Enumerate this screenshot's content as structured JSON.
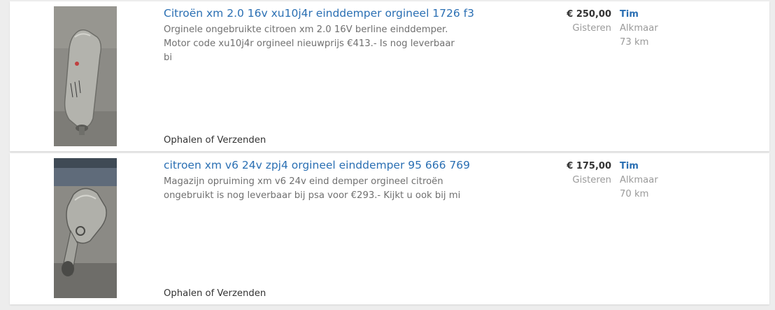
{
  "listings": [
    {
      "title": "Citroën xm 2.0 16v xu10j4r einddemper orgineel 1726 f3",
      "description": "Orginele ongebruikte citroen xm 2.0 16V berline einddemper. Motor code xu10j4r orgineel nieuwprijs €413.- Is nog leverbaar bi",
      "price": "€ 250,00",
      "date": "Gisteren",
      "seller": "Tim",
      "location": "Alkmaar",
      "distance": "73 km",
      "delivery": "Ophalen of Verzenden",
      "image_alt": "muffler-photo"
    },
    {
      "title": "citroen xm v6 24v zpj4 orgineel einddemper 95 666 769",
      "description": "Magazijn opruiming xm v6 24v eind demper orgineel citroën ongebruikt is nog leverbaar bij psa voor €293.- Kijkt u ook bij mi",
      "price": "€ 175,00",
      "date": "Gisteren",
      "seller": "Tim",
      "location": "Alkmaar",
      "distance": "70 km",
      "delivery": "Ophalen of Verzenden",
      "image_alt": "muffler-photo"
    }
  ]
}
